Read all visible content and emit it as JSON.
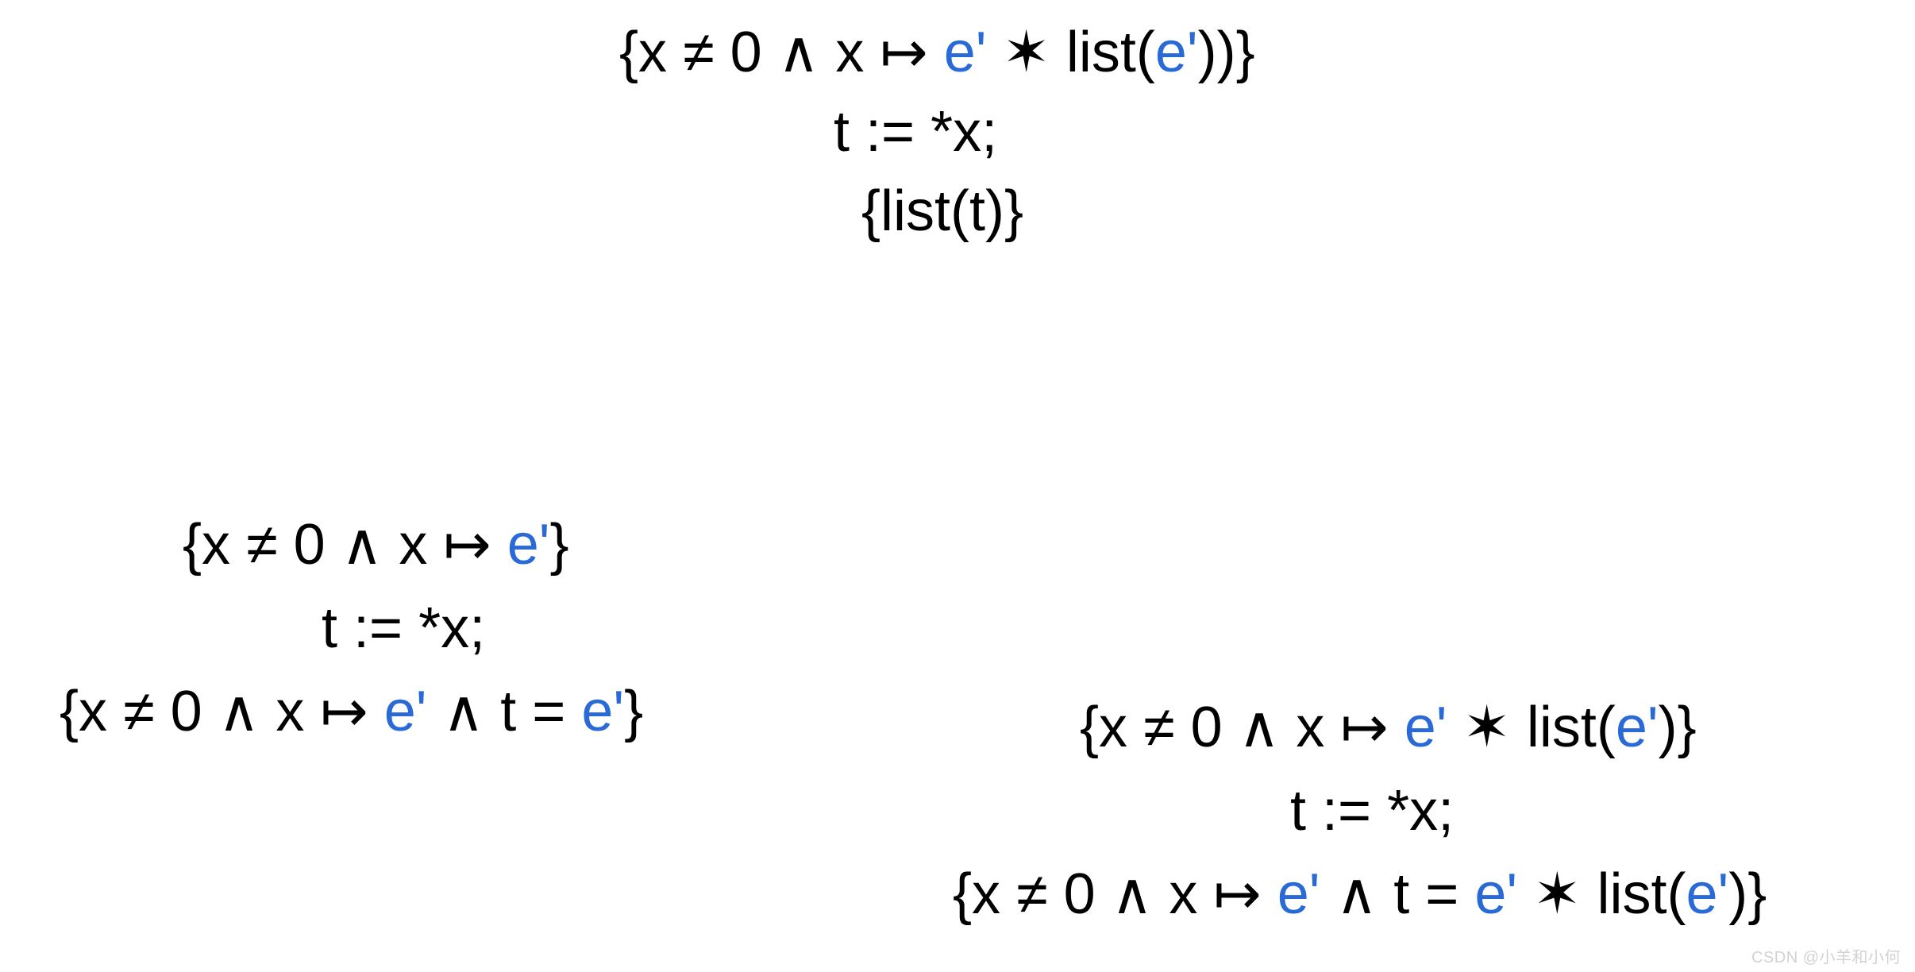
{
  "colors": {
    "accent": "#2a6ad6"
  },
  "sym": {
    "lbrace": "{",
    "rbrace": "}",
    "neq": "≠",
    "and": "∧",
    "mapsto": "↦",
    "star": "✶",
    "assign": ":=",
    "deref": "*",
    "eq": "=",
    "semi": ";",
    "rparen": ")",
    "lparen": "("
  },
  "tok": {
    "x": "x",
    "zero": "0",
    "eprime": "e'",
    "list": "list",
    "t": "t"
  },
  "watermark": "CSDN @小羊和小何"
}
